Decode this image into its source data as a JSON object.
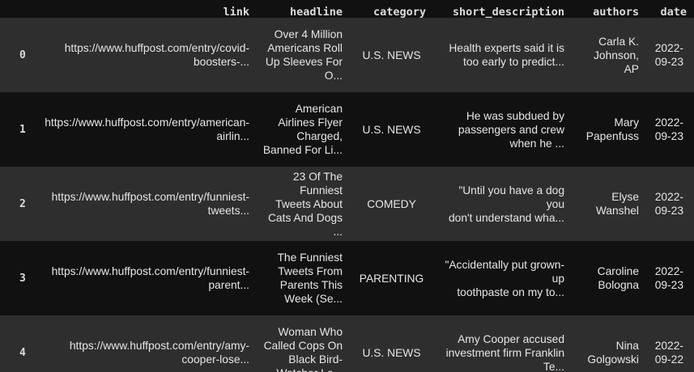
{
  "columns": [
    "link",
    "headline",
    "category",
    "short_description",
    "authors",
    "date"
  ],
  "rows": [
    {
      "index": "0",
      "link": [
        "https://www.huffpost.com/entry/covid-",
        "boosters-..."
      ],
      "headline": [
        "Over 4 Million",
        "Americans Roll",
        "Up Sleeves For",
        "O..."
      ],
      "category": "U.S. NEWS",
      "short_description": [
        "Health experts said it is",
        "too early to predict..."
      ],
      "authors": [
        "Carla K.",
        "Johnson,",
        "AP"
      ],
      "date": [
        "2022-",
        "09-23"
      ]
    },
    {
      "index": "1",
      "link": [
        "https://www.huffpost.com/entry/american-",
        "airlin..."
      ],
      "headline": [
        "American",
        "Airlines Flyer",
        "Charged,",
        "Banned For Li..."
      ],
      "category": "U.S. NEWS",
      "short_description": [
        "He was subdued by",
        "passengers and crew",
        "when he ..."
      ],
      "authors": [
        "Mary",
        "Papenfuss"
      ],
      "date": [
        "2022-",
        "09-23"
      ]
    },
    {
      "index": "2",
      "link": [
        "https://www.huffpost.com/entry/funniest-",
        "tweets..."
      ],
      "headline": [
        "23 Of The",
        "Funniest",
        "Tweets About",
        "Cats And Dogs",
        "..."
      ],
      "category": "COMEDY",
      "short_description": [
        "\"Until you have a dog you",
        "don't understand wha..."
      ],
      "authors": [
        "Elyse",
        "Wanshel"
      ],
      "date": [
        "2022-",
        "09-23"
      ]
    },
    {
      "index": "3",
      "link": [
        "https://www.huffpost.com/entry/funniest-",
        "parent..."
      ],
      "headline": [
        "The Funniest",
        "Tweets From",
        "Parents This",
        "Week (Se..."
      ],
      "category": "PARENTING",
      "short_description": [
        "\"Accidentally put grown-up",
        "toothpaste on my to..."
      ],
      "authors": [
        "Caroline",
        "Bologna"
      ],
      "date": [
        "2022-",
        "09-23"
      ]
    },
    {
      "index": "4",
      "link": [
        "https://www.huffpost.com/entry/amy-",
        "cooper-lose..."
      ],
      "headline": [
        "Woman Who",
        "Called Cops On",
        "Black Bird-",
        "Watcher Lo..."
      ],
      "category": "U.S. NEWS",
      "short_description": [
        "Amy Cooper accused",
        "investment firm Franklin",
        "Te..."
      ],
      "authors": [
        "Nina",
        "Golgowski"
      ],
      "date": [
        "2022-",
        "09-22"
      ]
    }
  ]
}
